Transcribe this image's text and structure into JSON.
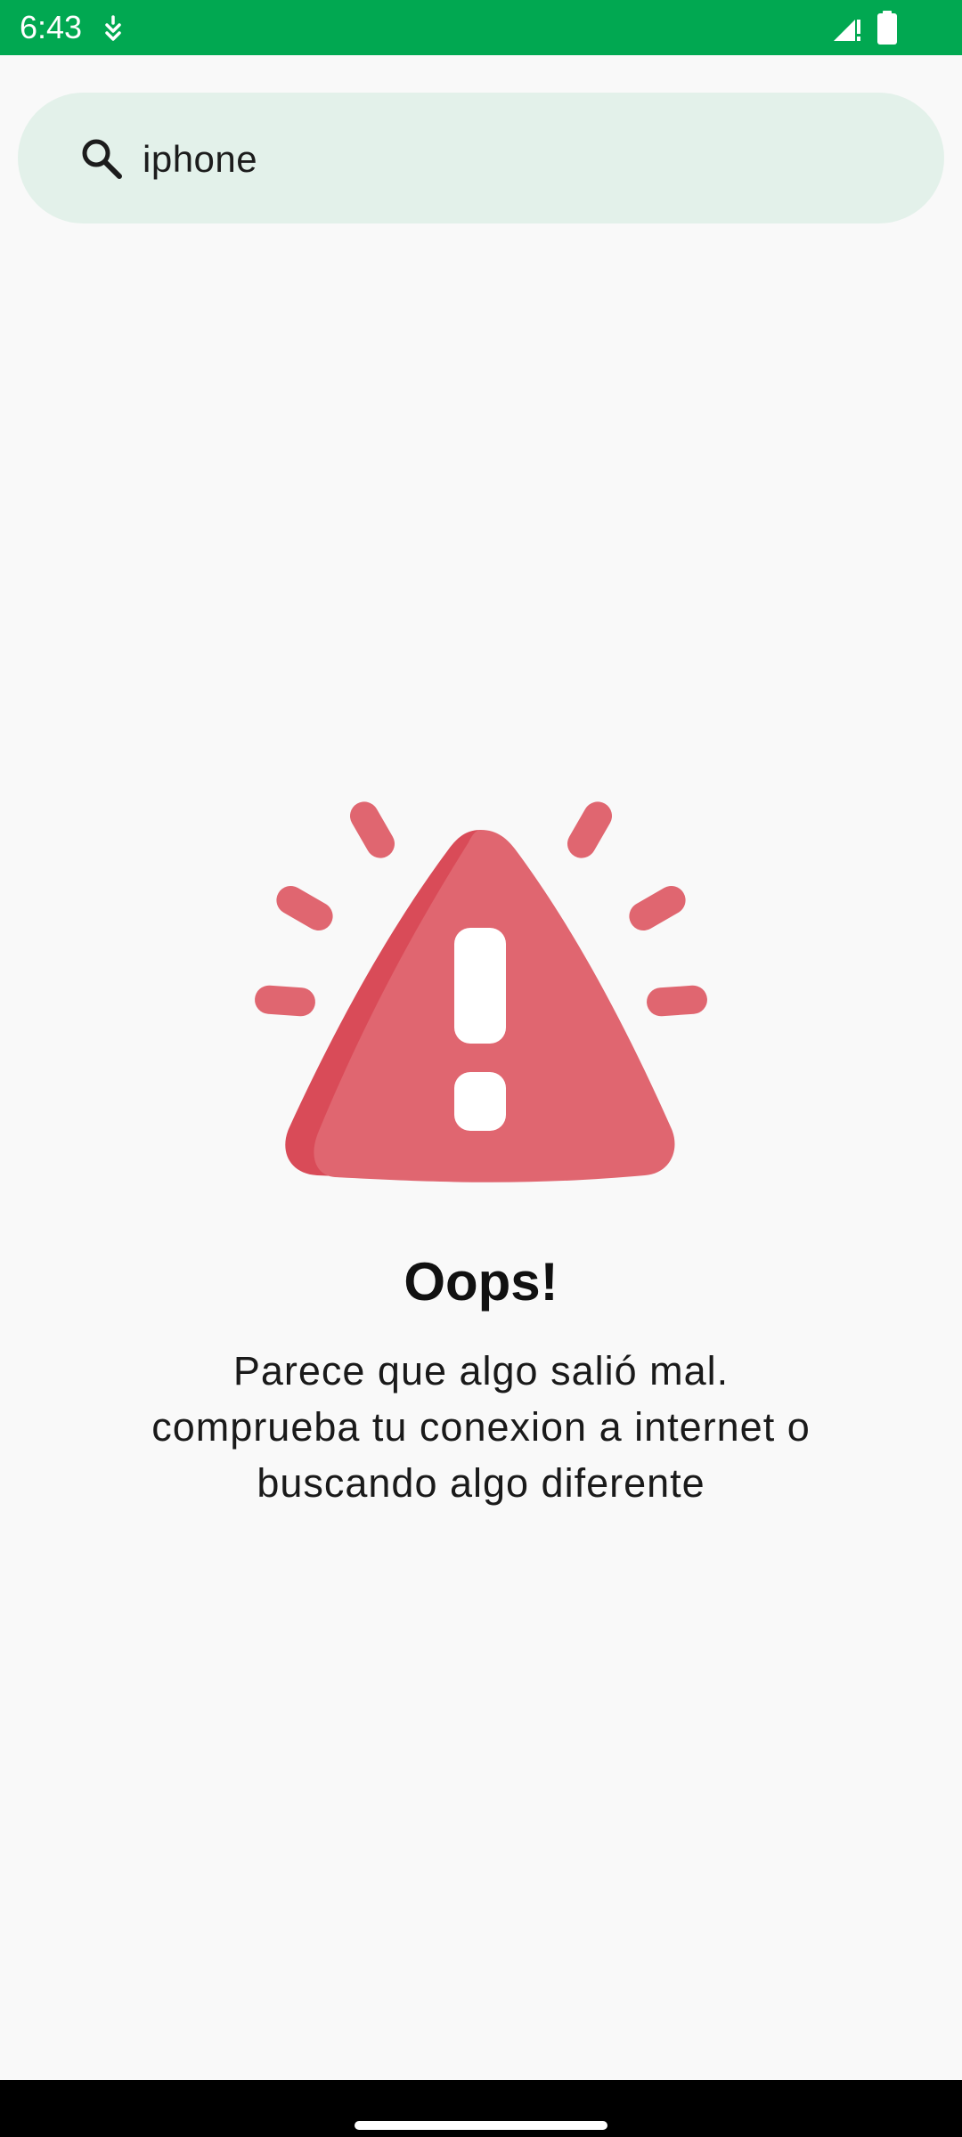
{
  "status_bar": {
    "time": "6:43",
    "background_color": "#01a851",
    "icons": [
      "notification-icon",
      "signal-icon",
      "battery-icon"
    ]
  },
  "search": {
    "value": "iphone",
    "icon": "search-icon",
    "background_color": "#e3f1ea"
  },
  "error": {
    "illustration_icon": "warning-triangle-icon",
    "illustration_color": "#e06670",
    "title": "Oops!",
    "message": "Parece que algo salió mal.\ncomprueba tu conexion a internet o\nbuscando algo diferente"
  }
}
